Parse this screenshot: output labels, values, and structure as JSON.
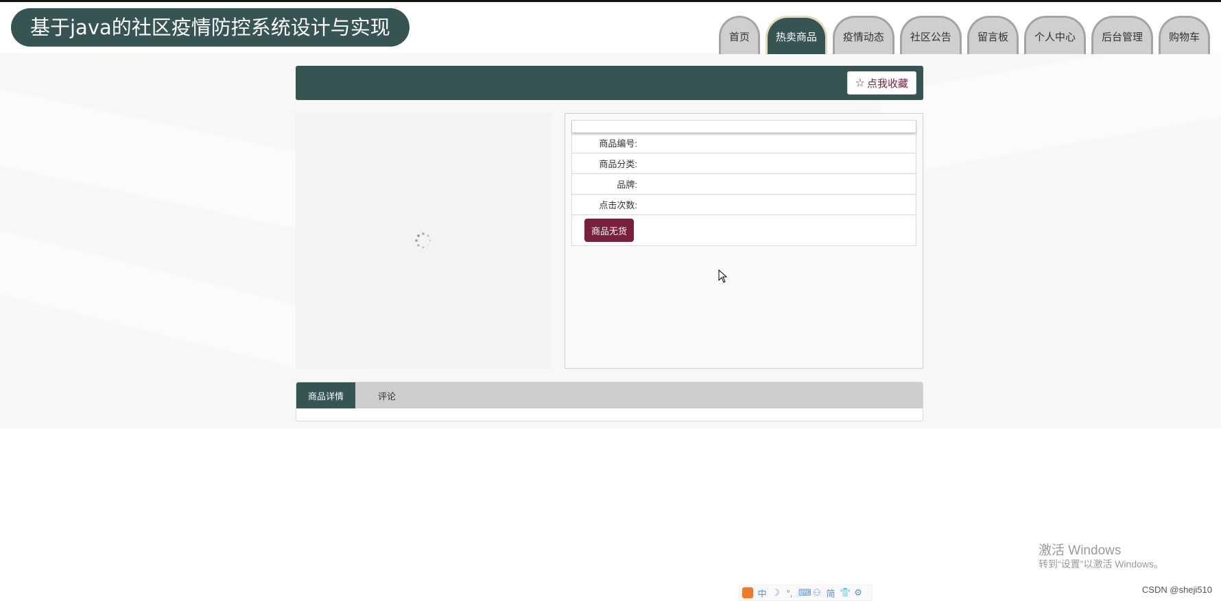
{
  "header": {
    "site_title": "基于java的社区疫情防控系统设计与实现",
    "nav": [
      {
        "label": "首页",
        "active": false
      },
      {
        "label": "热卖商品",
        "active": true
      },
      {
        "label": "疫情动态",
        "active": false
      },
      {
        "label": "社区公告",
        "active": false
      },
      {
        "label": "留言板",
        "active": false
      },
      {
        "label": "个人中心",
        "active": false
      },
      {
        "label": "后台管理",
        "active": false
      },
      {
        "label": "购物车",
        "active": false
      }
    ]
  },
  "page_header": {
    "favorite_label": "点我收藏",
    "favorite_icon": "star-outline-icon"
  },
  "product_info": {
    "title": "",
    "fields": [
      {
        "label": "商品编号:",
        "value": ""
      },
      {
        "label": "商品分类:",
        "value": ""
      },
      {
        "label": "品牌:",
        "value": ""
      },
      {
        "label": "点击次数:",
        "value": ""
      }
    ],
    "stock_button": "商品无货"
  },
  "tabs": [
    {
      "label": "商品详情",
      "active": true
    },
    {
      "label": "评论",
      "active": false
    }
  ],
  "watermark": {
    "title": "激活 Windows",
    "subtitle": "转到“设置”以激活 Windows。"
  },
  "footer_credit": "CSDN @sheji510",
  "ime_bar": [
    "中",
    "☽",
    "°,",
    "⌨",
    "⚇",
    "简",
    "👕",
    "⚙"
  ],
  "colors": {
    "primary": "#355453",
    "accent": "#7b1f3f",
    "nav_bg": "#cfcfcf"
  }
}
